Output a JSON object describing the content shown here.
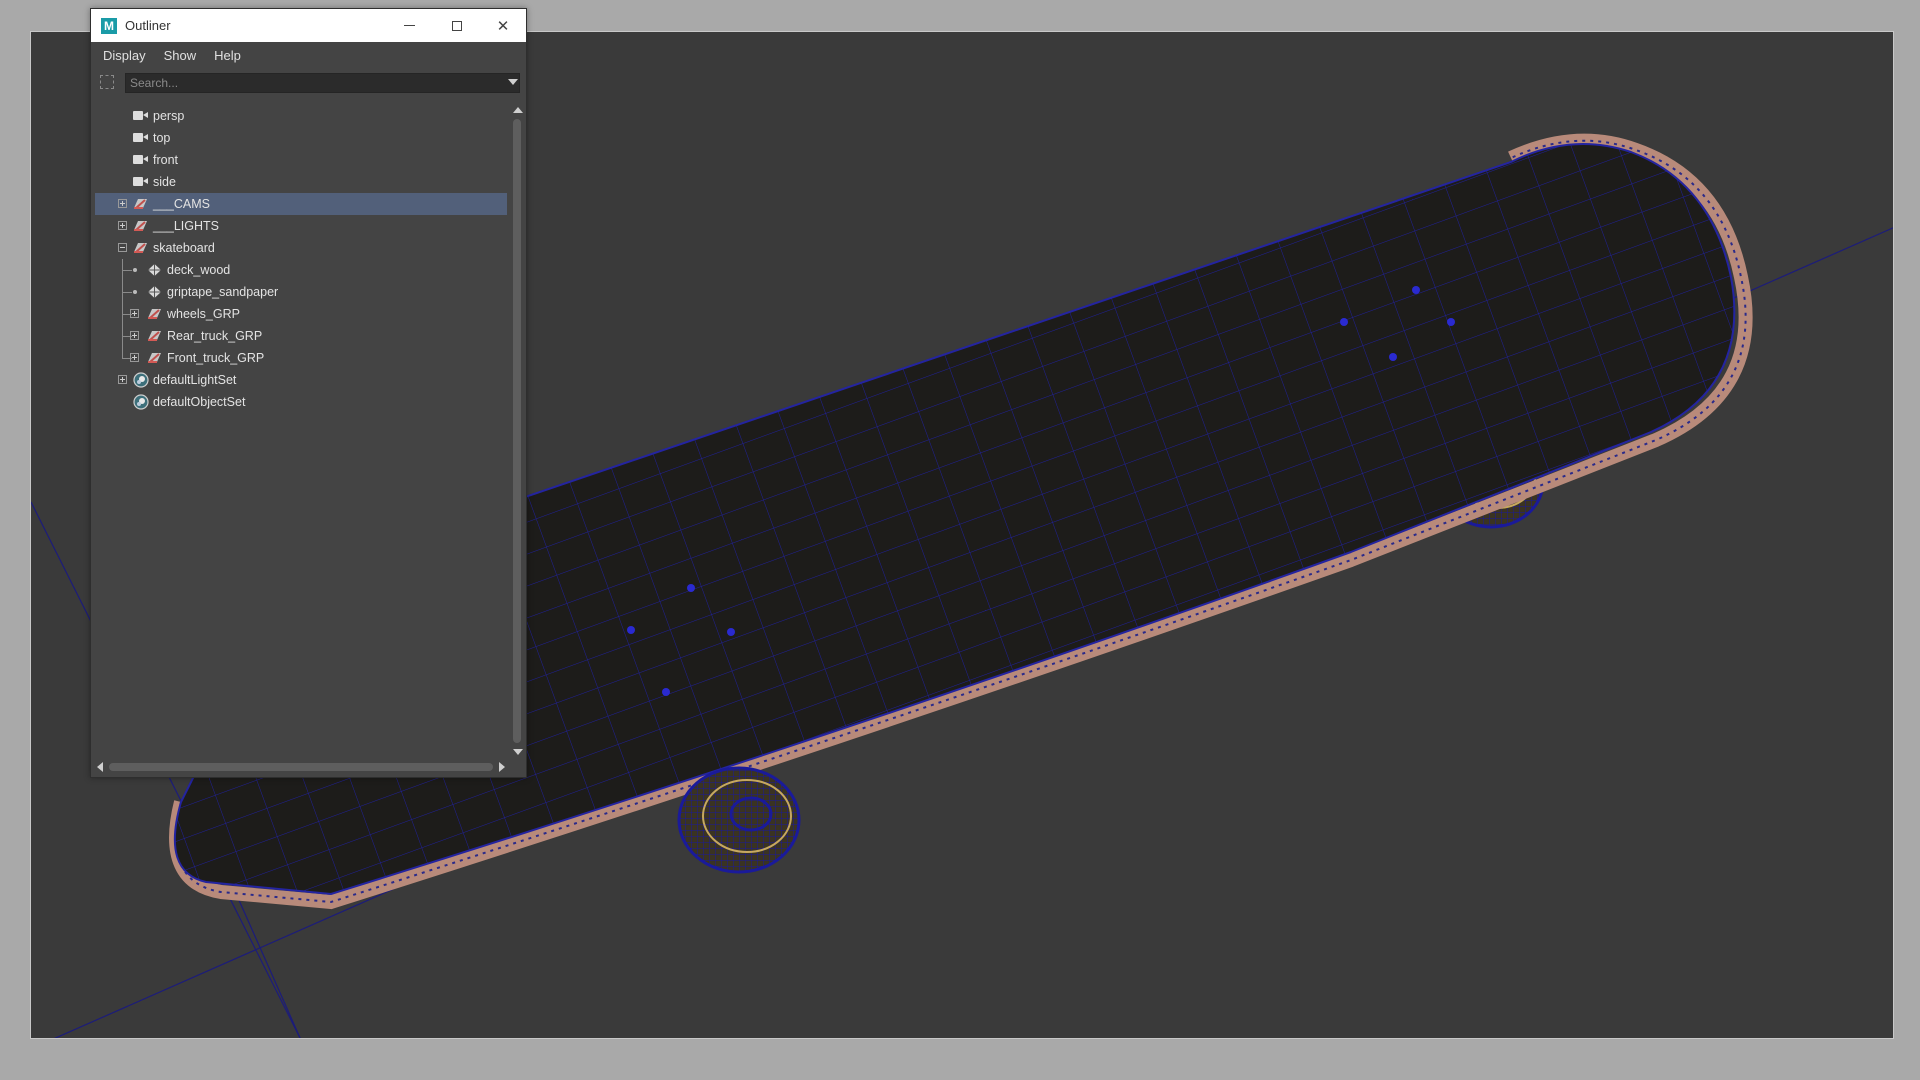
{
  "window": {
    "title": "Outliner",
    "app_icon_letter": "M",
    "accent_color": "#1a9ba7"
  },
  "menu": [
    "Display",
    "Show",
    "Help"
  ],
  "search": {
    "placeholder": "Search..."
  },
  "outliner": {
    "selection_color": "#52607a",
    "items": [
      {
        "label": "persp",
        "icon": "camera-icon"
      },
      {
        "label": "top",
        "icon": "camera-icon"
      },
      {
        "label": "front",
        "icon": "camera-icon"
      },
      {
        "label": "side",
        "icon": "camera-icon"
      },
      {
        "label": "___CAMS",
        "icon": "group-icon",
        "expander": "collapsed",
        "selected": true
      },
      {
        "label": "___LIGHTS",
        "icon": "group-icon",
        "expander": "collapsed"
      },
      {
        "label": "skateboard",
        "icon": "group-icon",
        "expander": "expanded"
      },
      {
        "label": "deck_wood",
        "icon": "mesh-icon",
        "parent": "skateboard"
      },
      {
        "label": "griptape_sandpaper",
        "icon": "mesh-icon",
        "parent": "skateboard"
      },
      {
        "label": "wheels_GRP",
        "icon": "group-icon",
        "expander": "collapsed",
        "parent": "skateboard"
      },
      {
        "label": "Rear_truck_GRP",
        "icon": "group-icon",
        "expander": "collapsed",
        "parent": "skateboard"
      },
      {
        "label": "Front_truck_GRP",
        "icon": "group-icon",
        "expander": "collapsed",
        "parent": "skateboard"
      },
      {
        "label": "defaultLightSet",
        "icon": "set-icon",
        "expander": "collapsed"
      },
      {
        "label": "defaultObjectSet",
        "icon": "set-icon"
      }
    ]
  },
  "viewport": {
    "background_color": "#3a3a3a",
    "wireframe_color": "#1a1a9a",
    "edge_color": "#b88a7a",
    "object": "skateboard"
  }
}
